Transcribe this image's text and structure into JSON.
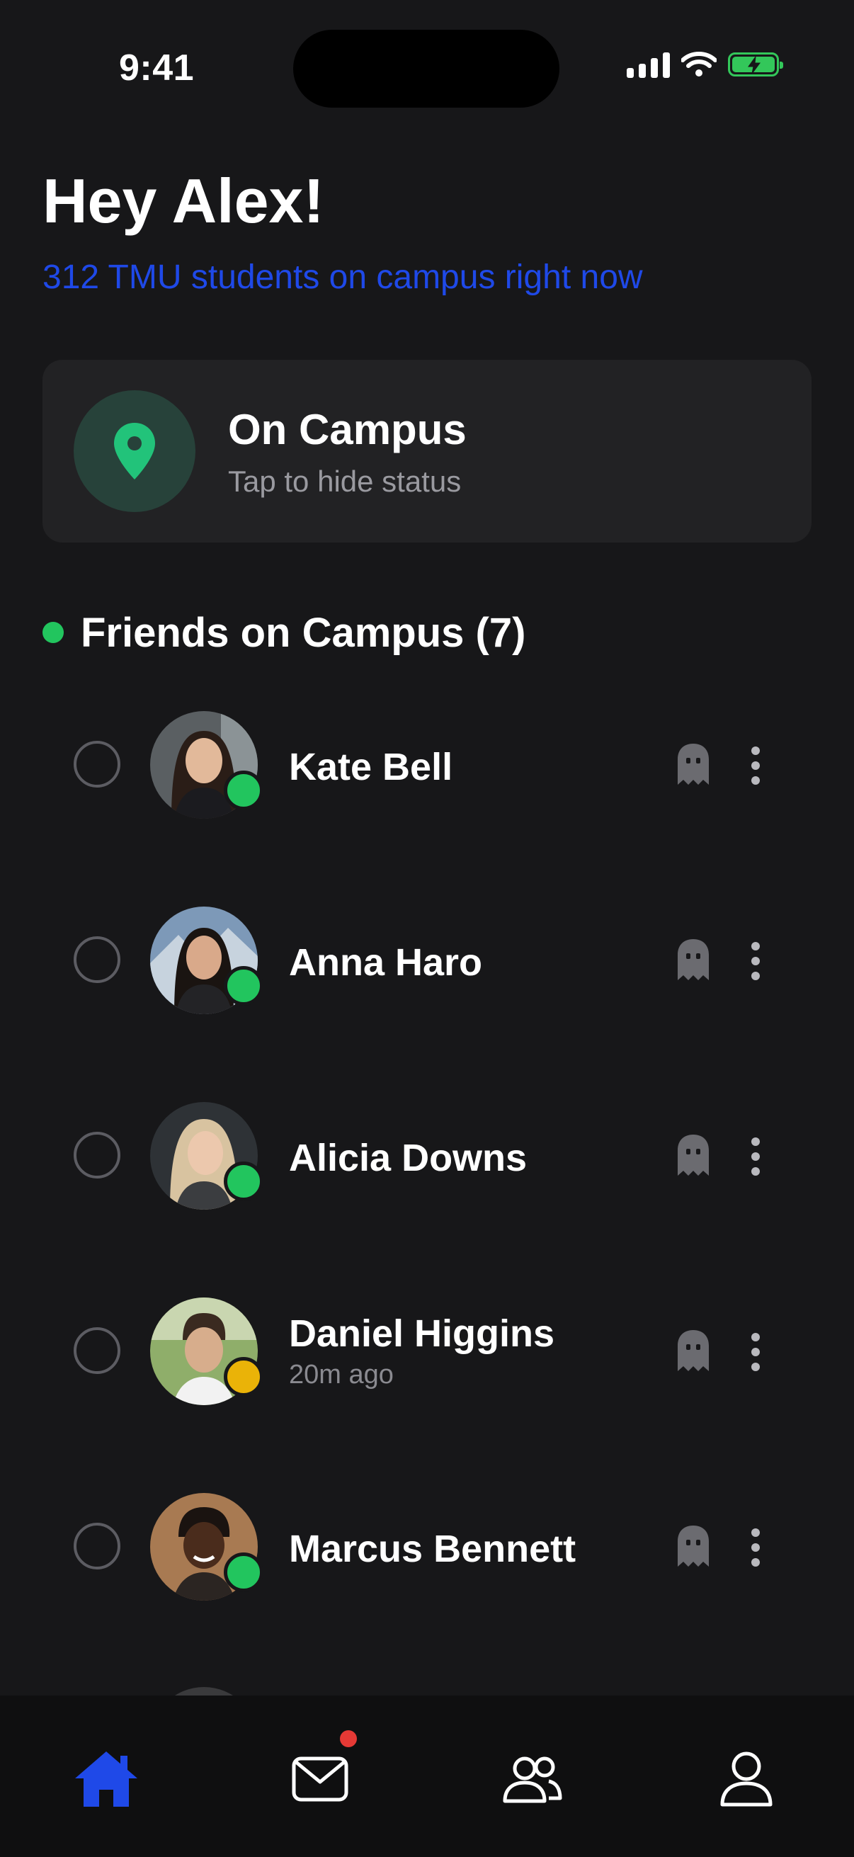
{
  "status_bar": {
    "time": "9:41"
  },
  "header": {
    "greeting": "Hey Alex!",
    "subtitle": "312 TMU students on campus right now"
  },
  "status_card": {
    "title": "On Campus",
    "subtitle": "Tap to hide status",
    "icon": "location-pin-icon"
  },
  "section": {
    "title": "Friends on Campus (7)"
  },
  "friends": [
    {
      "name": "Kate Bell",
      "status": "online",
      "subtitle": ""
    },
    {
      "name": "Anna Haro",
      "status": "online",
      "subtitle": ""
    },
    {
      "name": "Alicia Downs",
      "status": "online",
      "subtitle": ""
    },
    {
      "name": "Daniel Higgins",
      "status": "away",
      "subtitle": "20m ago"
    },
    {
      "name": "Marcus Bennett",
      "status": "online",
      "subtitle": ""
    }
  ],
  "tabs": [
    {
      "name": "home",
      "icon": "home-icon",
      "active": true
    },
    {
      "name": "messages",
      "icon": "mail-icon",
      "active": false,
      "badge": true
    },
    {
      "name": "friends",
      "icon": "people-icon",
      "active": false
    },
    {
      "name": "profile",
      "icon": "person-icon",
      "active": false
    }
  ],
  "colors": {
    "background": "#171719",
    "accent": "#1f49e8",
    "online": "#22c55e",
    "away": "#eab308",
    "badge": "#e53935"
  }
}
